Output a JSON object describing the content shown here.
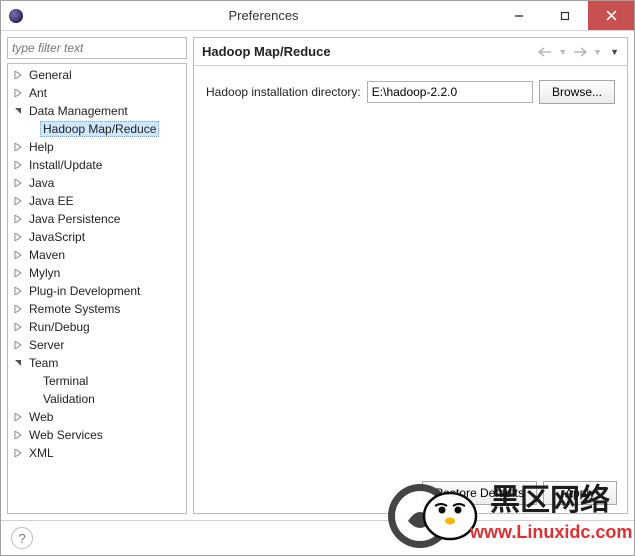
{
  "window": {
    "title": "Preferences"
  },
  "filter": {
    "placeholder": "type filter text"
  },
  "tree": [
    {
      "label": "General",
      "expandable": true
    },
    {
      "label": "Ant",
      "expandable": true
    },
    {
      "label": "Data Management",
      "expandable": true,
      "expanded": true,
      "children": [
        {
          "label": "Hadoop Map/Reduce",
          "selected": true
        }
      ]
    },
    {
      "label": "Help",
      "expandable": true
    },
    {
      "label": "Install/Update",
      "expandable": true
    },
    {
      "label": "Java",
      "expandable": true
    },
    {
      "label": "Java EE",
      "expandable": true
    },
    {
      "label": "Java Persistence",
      "expandable": true
    },
    {
      "label": "JavaScript",
      "expandable": true
    },
    {
      "label": "Maven",
      "expandable": true
    },
    {
      "label": "Mylyn",
      "expandable": true
    },
    {
      "label": "Plug-in Development",
      "expandable": true
    },
    {
      "label": "Remote Systems",
      "expandable": true
    },
    {
      "label": "Run/Debug",
      "expandable": true
    },
    {
      "label": "Server",
      "expandable": true
    },
    {
      "label": "Team",
      "expandable": true,
      "expanded": true,
      "children": [
        {
          "label": "Terminal"
        }
      ]
    },
    {
      "label": "Validation",
      "expandable": false,
      "indent": 1
    },
    {
      "label": "Web",
      "expandable": true
    },
    {
      "label": "Web Services",
      "expandable": true
    },
    {
      "label": "XML",
      "expandable": true
    }
  ],
  "page": {
    "title": "Hadoop Map/Reduce",
    "field_label": "Hadoop installation directory:",
    "field_value": "E:\\hadoop-2.2.0",
    "browse_label": "Browse...",
    "restore_label": "Restore Defaults",
    "apply_label": "Apply"
  },
  "watermark": {
    "text1": "黑区网络",
    "text2": "www.Linuxidc.com"
  }
}
